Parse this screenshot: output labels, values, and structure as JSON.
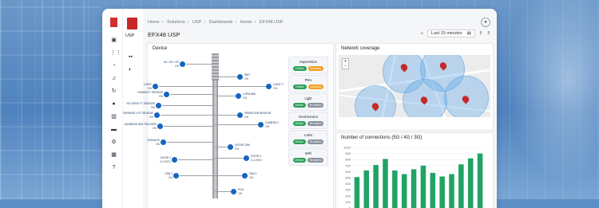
{
  "app": {
    "section_label": "USP"
  },
  "breadcrumb": [
    "Home",
    "Solutions",
    "USP",
    "Dashboards",
    "Home",
    "EFX48 USP"
  ],
  "page": {
    "title": "EFX48 USP",
    "time_range": "Last 15 minutes"
  },
  "device_panel": {
    "title": "Device",
    "sensors": [
      {
        "name": "4G / 3G / 2G",
        "value": "ON"
      },
      {
        "name": "LIGHT",
        "value": "ON"
      },
      {
        "name": "HUMIDITY SENSOR",
        "value": "ON"
      },
      {
        "name": "WIFI",
        "value": "ON"
      },
      {
        "name": "LIGHT 2",
        "value": "ON"
      },
      {
        "name": "LORA 868",
        "value": "ON"
      },
      {
        "name": "NO SENS TT SENSOR",
        "value": "ON"
      },
      {
        "name": "PARKING LOT SENSOR",
        "value": "ON"
      },
      {
        "name": "VIBRATION SENSOR",
        "value": "ON"
      },
      {
        "name": "GARBAGE BIN TRACKER",
        "value": "ON"
      },
      {
        "name": "CAMERA 1",
        "value": "ON"
      },
      {
        "name": "SIGNAGE",
        "value": "ON"
      },
      {
        "name": "DOOR CAM",
        "value": "ON"
      },
      {
        "name": "DOOR 1",
        "value": "CLOSED"
      },
      {
        "name": "DOOR 2",
        "value": "CLOSED"
      },
      {
        "name": "FAN 1",
        "value": "ON"
      },
      {
        "name": "FAN 2",
        "value": "ON"
      },
      {
        "name": "PDU",
        "value": "ON"
      }
    ],
    "status_cards": [
      {
        "title": "Supervision",
        "badges": [
          {
            "text": "Online",
            "kind": "on"
          },
          {
            "text": "Warning",
            "kind": "warn"
          }
        ]
      },
      {
        "title": "PDU",
        "badges": [
          {
            "text": "Online",
            "kind": "on"
          },
          {
            "text": "Warning",
            "kind": "warn"
          }
        ]
      },
      {
        "title": "Light",
        "badges": [
          {
            "text": "Online",
            "kind": "on"
          },
          {
            "text": "No alarm",
            "kind": "gray"
          }
        ]
      },
      {
        "title": "Environment",
        "badges": [
          {
            "text": "Online",
            "kind": "on"
          },
          {
            "text": "No alarm",
            "kind": "gray"
          }
        ]
      },
      {
        "title": "LoRa",
        "badges": [
          {
            "text": "Online",
            "kind": "on"
          },
          {
            "text": "No alarm",
            "kind": "gray"
          }
        ]
      },
      {
        "title": "WiFi",
        "badges": [
          {
            "text": "Online",
            "kind": "on"
          },
          {
            "text": "No alarm",
            "kind": "gray"
          }
        ]
      }
    ]
  },
  "map_panel": {
    "title": "Network coverage",
    "zoom_in": "+",
    "zoom_out": "−"
  },
  "chart_panel": {
    "title": "Number of connections (5G / 4G / 3G)"
  },
  "chart_data": {
    "type": "bar",
    "title": "Number of connections (5G / 4G / 3G)",
    "ylim": [
      0,
      1000
    ],
    "yticks": [
      0,
      100,
      200,
      300,
      400,
      500,
      600,
      700,
      800,
      900,
      1000
    ],
    "values": [
      510,
      620,
      710,
      810,
      620,
      560,
      640,
      700,
      580,
      520,
      560,
      720,
      820,
      900
    ],
    "color": "#21a366"
  },
  "colors": {
    "accent": "#1565c0",
    "brand": "#c62828",
    "online": "#2ca05a",
    "warning": "#f0a020"
  }
}
